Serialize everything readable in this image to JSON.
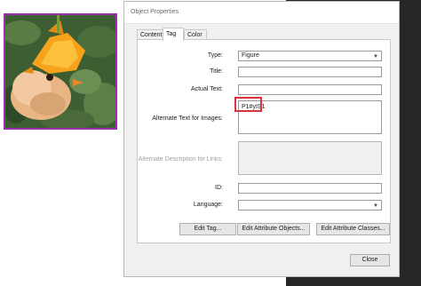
{
  "dialog": {
    "title": "Object Properties",
    "tabs": [
      {
        "label": "Content"
      },
      {
        "label": "Tag",
        "active": true
      },
      {
        "label": "Color"
      }
    ]
  },
  "form": {
    "type_label": "Type:",
    "type_value": "Figure",
    "title_label": "Title:",
    "title_value": "",
    "actual_text_label": "Actual Text:",
    "actual_text_value": "",
    "alt_text_label": "Alternate Text for Images:",
    "alt_text_value": "P1#yIS1",
    "alt_desc_label": "Alternate Description for Links:",
    "id_label": "ID:",
    "id_value": "",
    "language_label": "Language:",
    "language_value": ""
  },
  "buttons": {
    "edit_tag": "Edit Tag...",
    "edit_attribute_objects": "Edit Attribute Objects...",
    "edit_attribute_classes": "Edit Attribute Classes...",
    "close": "Close"
  },
  "colors": {
    "highlight": "#d9343a",
    "thumbnail_border": "#9b2fae"
  },
  "icons": {
    "dropdown": "chevron-down-icon"
  }
}
